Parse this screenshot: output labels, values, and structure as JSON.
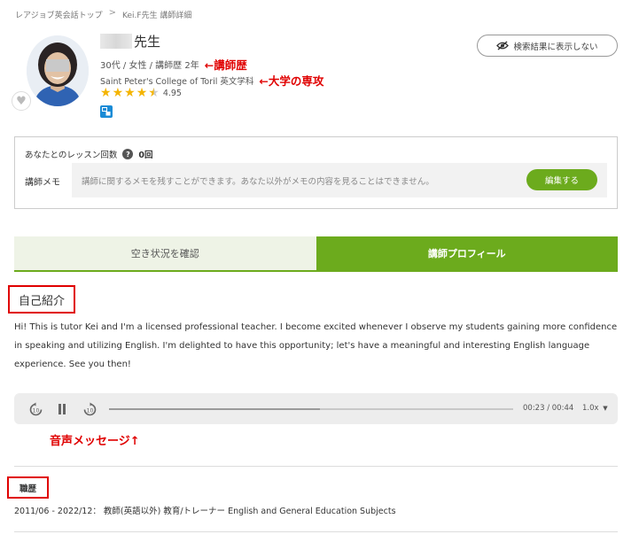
{
  "breadcrumb": {
    "home": "レアジョブ英会話トップ",
    "separator": ">",
    "current": "Kei.F先生 講師詳細"
  },
  "teacher": {
    "name_suffix": "先生",
    "meta": "30代 / 女性 / 講師歴 2年",
    "experience_annotation": "←講師歴",
    "college": "Saint Peter's College of Toril 英文学科",
    "major_annotation": "←大学の専攻",
    "rating": "4.95",
    "rating_stars": 4.5
  },
  "hide_button": {
    "label": "検索結果に表示しない"
  },
  "lesson_box": {
    "count_label": "あなたとのレッスン回数",
    "help_icon_text": "?",
    "count_value": "0回",
    "memo_label": "講師メモ",
    "memo_placeholder": "講師に関するメモを残すことができます。あなた以外がメモの内容を見ることはできません。",
    "edit_button": "編集する"
  },
  "tabs": [
    {
      "label": "空き状況を確認",
      "active": false
    },
    {
      "label": "講師プロフィール",
      "active": true
    }
  ],
  "intro": {
    "title": "自己紹介",
    "text": "Hi! This is tutor Kei and I'm a licensed professional teacher. I become excited whenever I observe my students gaining more confidence in speaking and utilizing English. I'm delighted to have this opportunity; let's have a meaningful and interesting English language experience. See you then!"
  },
  "audio": {
    "time": "00:23 / 00:44",
    "speed": "1.0x",
    "progress": 0.523,
    "icons": [
      "rewind-10-icon",
      "pause-icon",
      "forward-10-icon"
    ]
  },
  "voice_annotation": "音声メッセージ↑",
  "career": {
    "title": "職歴",
    "entry": "2011/06 - 2022/12： 教師(英語以外) 教育/トレーナー English and General Education Subjects"
  },
  "colors": {
    "accent_green": "#6cab1d",
    "annotation_red": "#e00000",
    "star": "#f4b400"
  }
}
